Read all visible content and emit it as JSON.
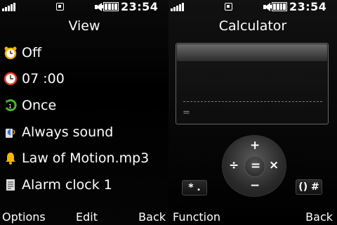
{
  "status": {
    "time": "23:54"
  },
  "alarm": {
    "title": "View",
    "items": [
      {
        "icon": "alarm-clock-icon",
        "label": "Off"
      },
      {
        "icon": "clock-icon",
        "label": "07 :00"
      },
      {
        "icon": "repeat-icon",
        "label": "Once"
      },
      {
        "icon": "sound-mode-icon",
        "label": "Always sound"
      },
      {
        "icon": "bell-icon",
        "label": "Law of Motion.mp3"
      },
      {
        "icon": "note-icon",
        "label": "Alarm clock 1"
      }
    ],
    "softkeys": {
      "left": "Options",
      "center": "Edit",
      "right": "Back"
    }
  },
  "calculator": {
    "title": "Calculator",
    "display_result": "=",
    "keys": {
      "plus": "+",
      "divide": "÷",
      "equals": "=",
      "multiply": "×",
      "minus": "−",
      "star_dot": "* .",
      "paren_hash": "() #"
    },
    "softkeys": {
      "left": "Function",
      "right": "Back"
    }
  },
  "colors": {
    "alarm_icon": "#f0b400",
    "clock_icon": "#e23b1c",
    "repeat_icon": "#4bb52f",
    "bell_icon": "#f5b700"
  }
}
